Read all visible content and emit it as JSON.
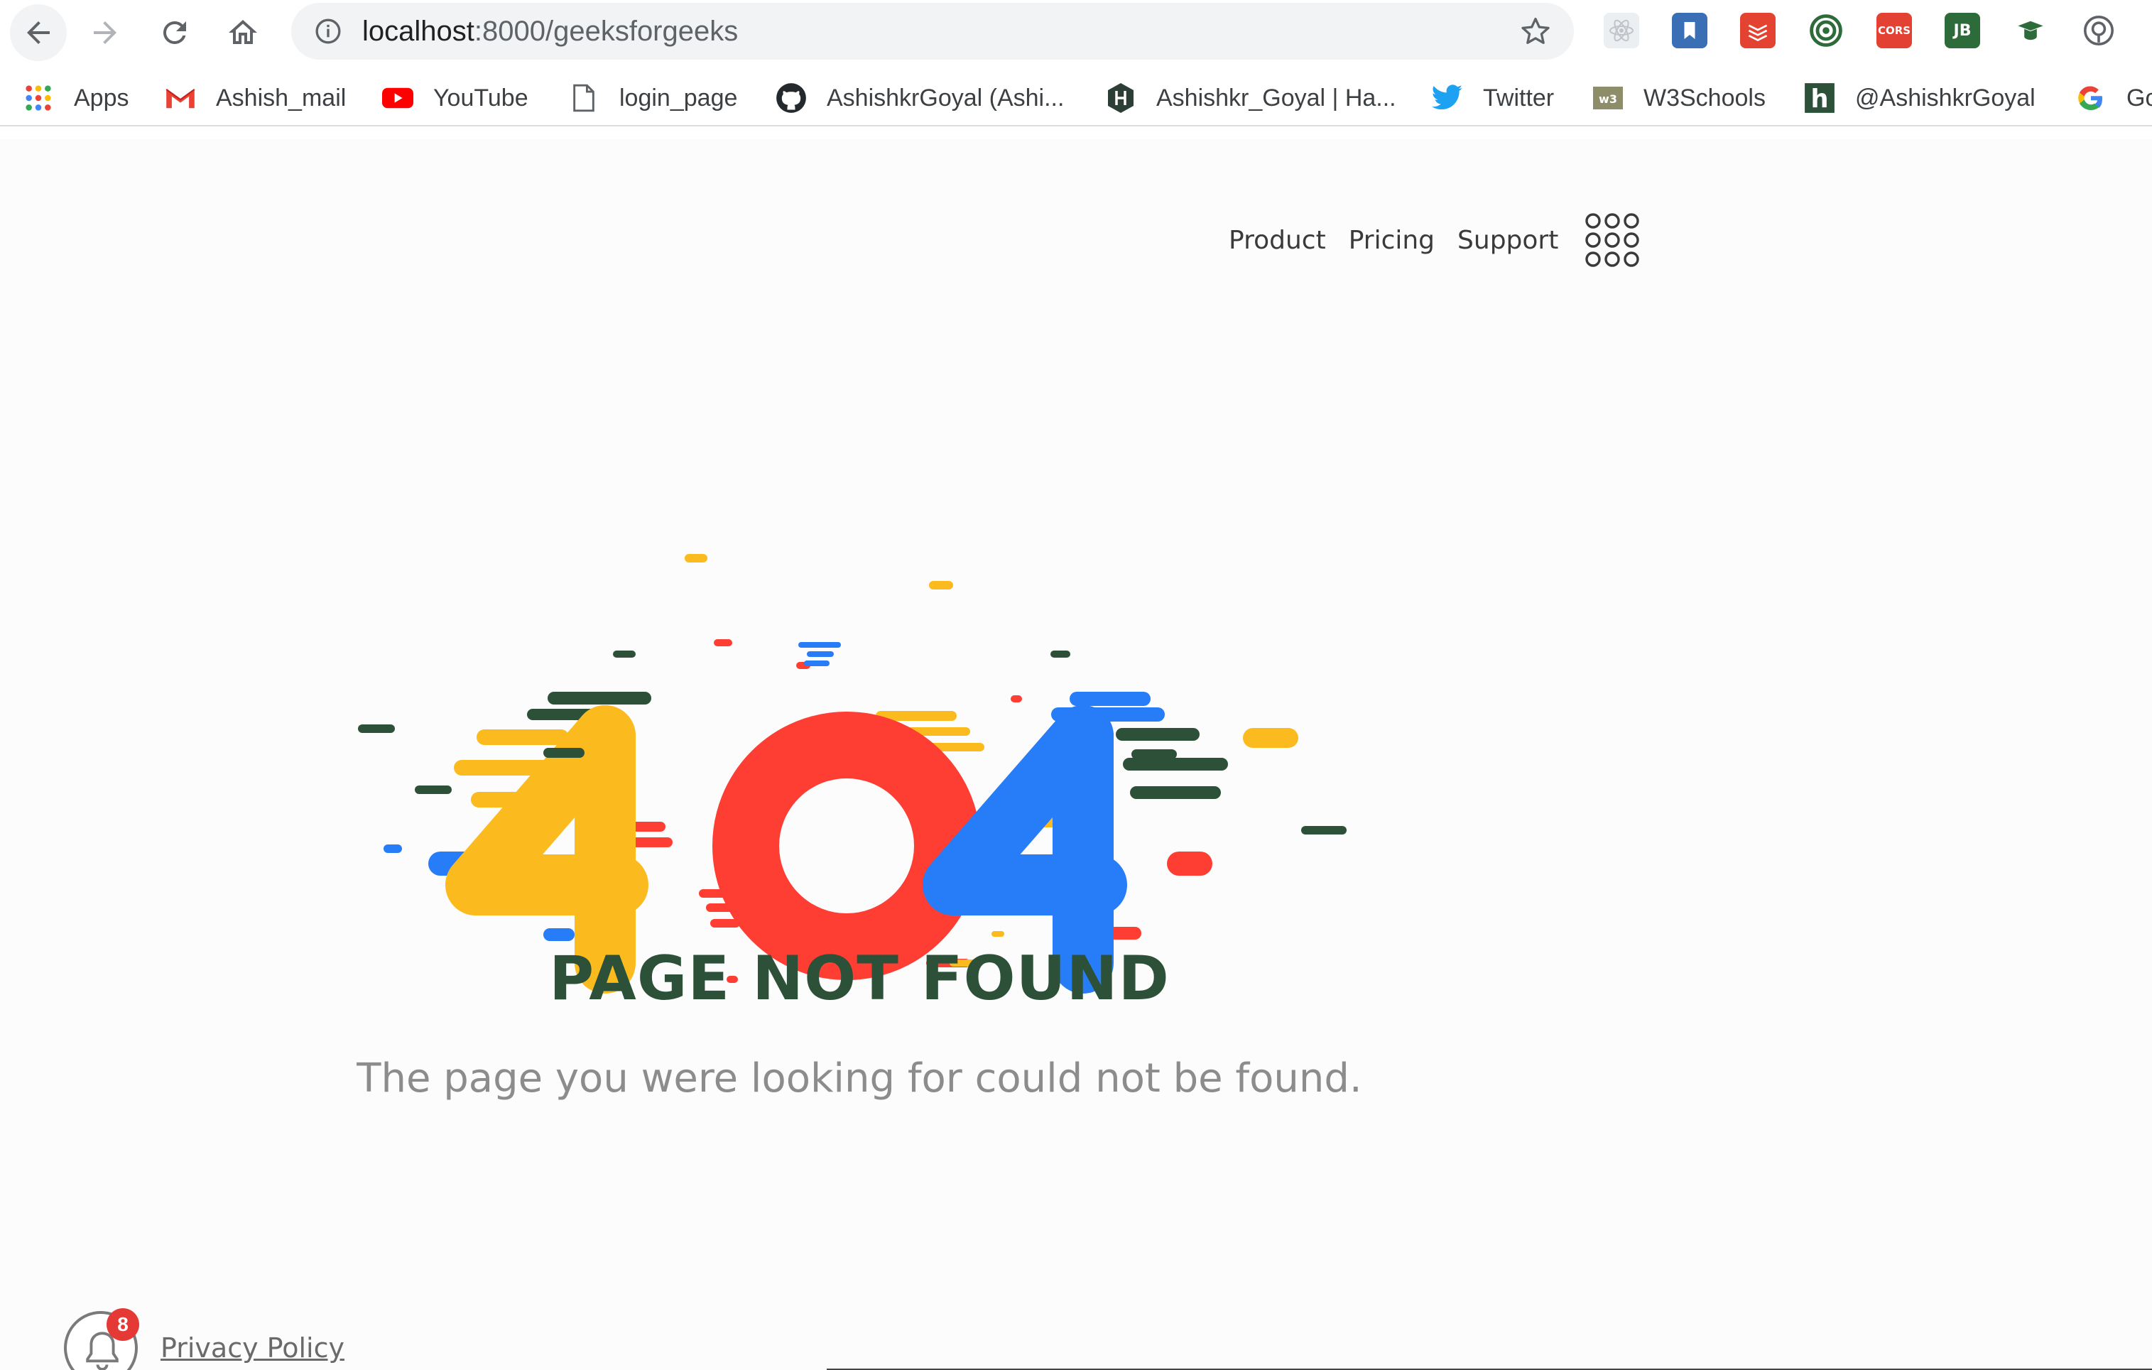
{
  "browser": {
    "url_host": "localhost",
    "url_path": ":8000/geeksforgeeks"
  },
  "extensions": [
    {
      "icon": "react-devtools-icon",
      "color": "#e8eaed"
    },
    {
      "icon": "bookmark-manager-icon",
      "color": "#3b6fb5"
    },
    {
      "icon": "todoist-icon",
      "color": "#e44332"
    },
    {
      "icon": "tracker-icon",
      "color": "#2e6b3a"
    },
    {
      "icon": "cors-icon",
      "color": "#e34133",
      "text": "CORS"
    },
    {
      "icon": "jetbrains-icon",
      "color": "#2e6b3a",
      "text": "JB"
    },
    {
      "icon": "grad-cap-icon",
      "color": "#2e6b3a"
    },
    {
      "icon": "octotree-icon",
      "color": "#5f6368"
    }
  ],
  "bookmarks": [
    {
      "label": "Apps",
      "icon": "apps-grid-icon"
    },
    {
      "label": "Ashish_mail",
      "icon": "gmail-icon"
    },
    {
      "label": "YouTube",
      "icon": "youtube-icon"
    },
    {
      "label": "login_page",
      "icon": "page-icon"
    },
    {
      "label": "AshishkrGoyal (Ashi...",
      "icon": "github-icon"
    },
    {
      "label": "Ashishkr_Goyal | Ha...",
      "icon": "hackerrank-icon"
    },
    {
      "label": "Twitter",
      "icon": "twitter-icon"
    },
    {
      "label": "W3Schools",
      "icon": "w3schools-icon"
    },
    {
      "label": "@AshishkrGoyal",
      "icon": "hashnode-icon"
    },
    {
      "label": "Go",
      "icon": "google-icon"
    }
  ],
  "page": {
    "nav": [
      "Product",
      "Pricing",
      "Support"
    ],
    "illustration_text": "404",
    "heading": "PAGE NOT FOUND",
    "subheading": "The page you were looking for could not be found.",
    "footer_link": "Privacy Policy",
    "notification_count": "8"
  },
  "colors": {
    "yellow": "#fbbb1f",
    "red": "#fe3d33",
    "blue": "#277cf8",
    "green": "#2c5138"
  }
}
